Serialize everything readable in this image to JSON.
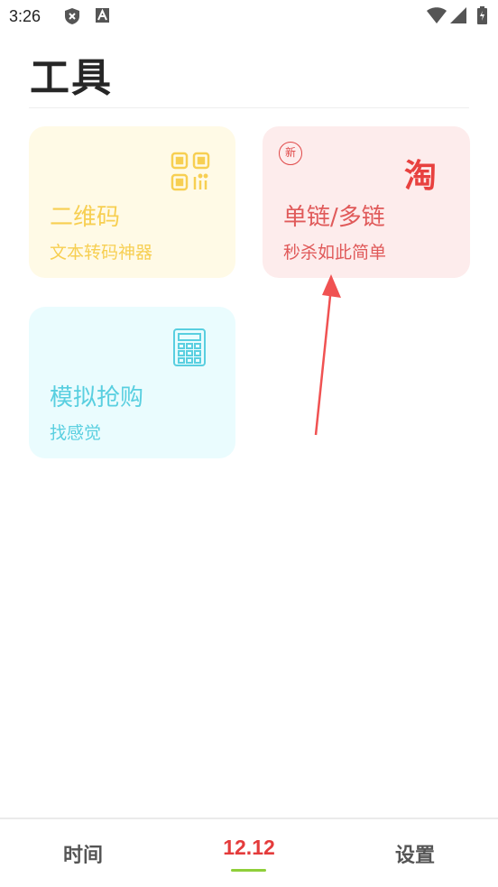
{
  "status_bar": {
    "time": "3:26",
    "icons": [
      "shield-icon",
      "font-a-icon",
      "wifi-icon",
      "signal-icon",
      "battery-charging-icon"
    ]
  },
  "page": {
    "title": "工具"
  },
  "cards": {
    "qr": {
      "title": "二维码",
      "subtitle": "文本转码神器",
      "icon": "qr-code-icon"
    },
    "link": {
      "badge": "新",
      "logo": "淘",
      "title": "单链/多链",
      "subtitle": "秒杀如此简单",
      "icon": "taobao-logo-icon"
    },
    "sim": {
      "title": "模拟抢购",
      "subtitle": "找感觉",
      "icon": "calculator-icon"
    }
  },
  "bottom_nav": {
    "items": [
      {
        "label": "时间"
      },
      {
        "label": "12.12",
        "active": true
      },
      {
        "label": "设置"
      }
    ]
  },
  "colors": {
    "qr_accent": "#f7cf52",
    "link_accent": "#e05a5a",
    "sim_accent": "#59cfe0",
    "active_tab": "#e43b3b",
    "tab_indicator": "#8fcf3a"
  }
}
